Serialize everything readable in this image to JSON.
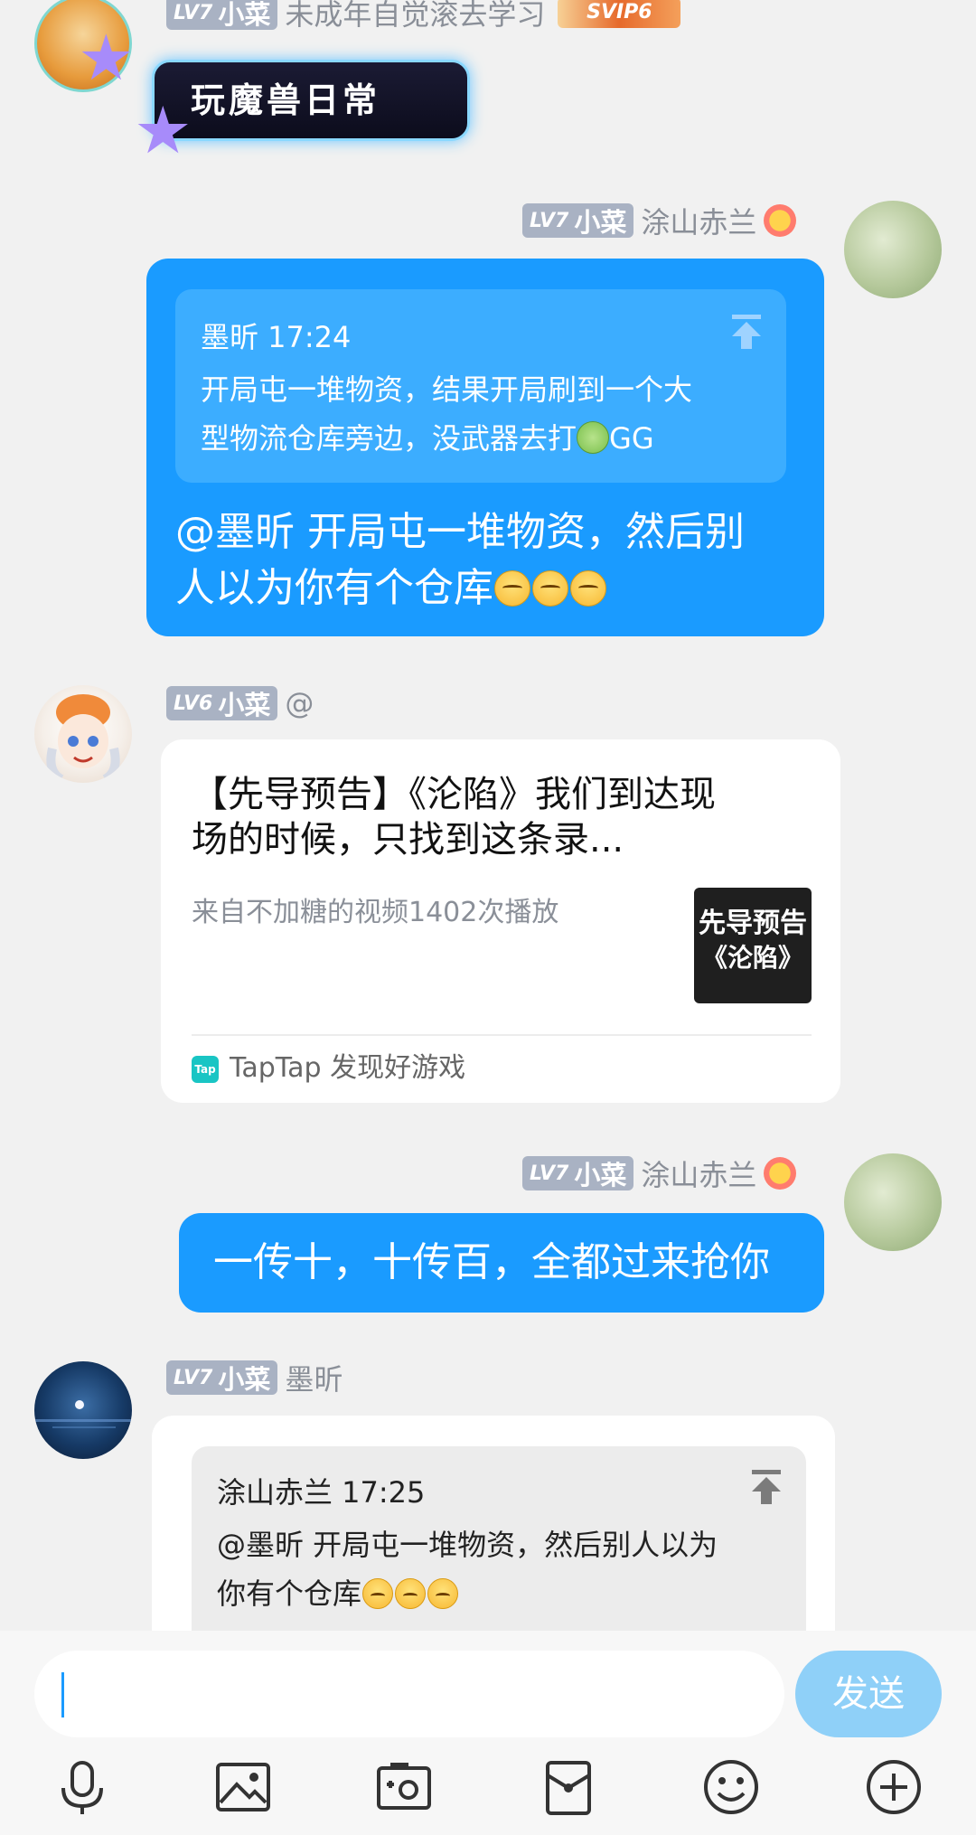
{
  "messages": {
    "m1": {
      "level_prefix": "LV7",
      "level_name": "小菜",
      "username": "未成年自觉滚去学习",
      "vip_text": "SVIP6",
      "title_tag": "玩魔兽日常"
    },
    "m2": {
      "level_prefix": "LV7",
      "level_name": "小菜",
      "username": "涂山赤兰",
      "quote_header": "墨昕 17:24",
      "quote_line1": "开局屯一堆物资，结果开局刷到一个大",
      "quote_line2": "型物流仓库旁边，没武器去打",
      "quote_line2_tail": "GG",
      "body_line1": "@墨昕 开局屯一堆物资，然后别",
      "body_line2": "人以为你有个仓库"
    },
    "m3": {
      "level_prefix": "LV6",
      "level_name": "小菜",
      "username": "@",
      "card_title_line1": "【先导预告】《沦陷》我们到达现",
      "card_title_line2": "场的时候，只找到这条录...",
      "card_meta": "来自不加糖的视频1402次播放",
      "thumb_line1": "先导预告",
      "thumb_line2": "《沦陷》",
      "source_logo": "Tap",
      "source_text": "TapTap 发现好游戏"
    },
    "m4": {
      "level_prefix": "LV7",
      "level_name": "小菜",
      "username": "涂山赤兰",
      "body": "一传十，十传百，全都过来抢你"
    },
    "m5": {
      "level_prefix": "LV7",
      "level_name": "小菜",
      "username": "墨昕",
      "quote_header": "涂山赤兰 17:25",
      "quote_line1": "@墨昕 开局屯一堆物资，然后别人以为",
      "quote_line2": "你有个仓库"
    }
  },
  "composer": {
    "input_value": "",
    "send_label": "发送",
    "tools": [
      "microphone-icon",
      "image-icon",
      "video-camera-icon",
      "red-packet-icon",
      "emoji-icon",
      "plus-icon"
    ]
  },
  "colors": {
    "accent": "#1a9bff",
    "background": "#f1f1f1",
    "level_badge": "#a9b2c3",
    "send_button": "#8fd0f8"
  }
}
